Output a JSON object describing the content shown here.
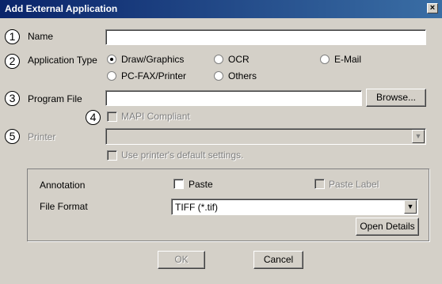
{
  "window": {
    "title": "Add External Application",
    "close_label": "×"
  },
  "markers": [
    "1",
    "2",
    "3",
    "4",
    "5"
  ],
  "form": {
    "name_label": "Name",
    "name_value": "",
    "app_type_label": "Application Type",
    "app_types": [
      "Draw/Graphics",
      "OCR",
      "E-Mail",
      "PC-FAX/Printer",
      "Others"
    ],
    "selected_app_type": "Draw/Graphics",
    "program_file_label": "Program File",
    "program_file_value": "",
    "browse_label": "Browse...",
    "mapi_label": "MAPI Compliant",
    "printer_label": "Printer",
    "printer_value": "",
    "use_default_label": "Use printer's default settings."
  },
  "group": {
    "annotation_label": "Annotation",
    "paste_label": "Paste",
    "paste_label_label": "Paste Label",
    "file_format_label": "File Format",
    "file_format_value": "TIFF (*.tif)",
    "open_details_label": "Open Details"
  },
  "footer": {
    "ok_label": "OK",
    "cancel_label": "Cancel"
  }
}
